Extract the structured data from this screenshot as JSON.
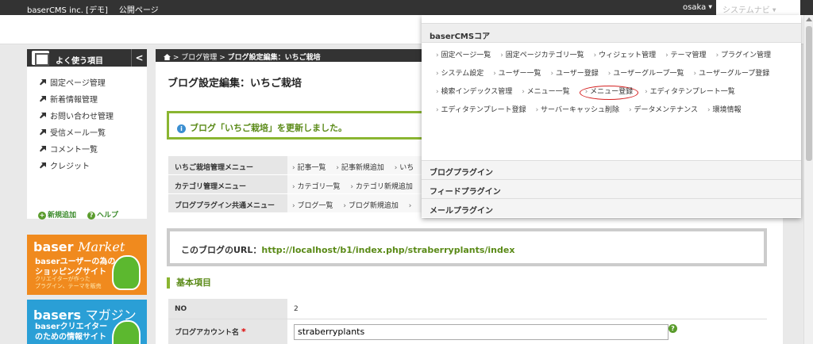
{
  "topbar": {
    "site_name": "baserCMS inc. [デモ]",
    "public_page": "公開ページ",
    "user": "osaka",
    "system_nav": "システムナビ"
  },
  "sidebar": {
    "title": "よく使う項目",
    "toggle": "<",
    "items": [
      {
        "label": "固定ページ管理"
      },
      {
        "label": "新着情報管理"
      },
      {
        "label": "お問い合わせ管理"
      },
      {
        "label": "受信メール一覧"
      },
      {
        "label": "コメント一覧"
      },
      {
        "label": "クレジット"
      }
    ],
    "add_new": "新規追加",
    "help": "ヘルプ"
  },
  "banners": {
    "market": {
      "title_a": "baser",
      "title_b": "Market",
      "line1": "baserユーザーの為の",
      "line2": "ショッピングサイト",
      "small1": "クリエイターが作った",
      "small2": "プラグイン、テーマを販売"
    },
    "magazine": {
      "title_a": "basers",
      "title_b": "マガジン",
      "line1": "baserクリエイター",
      "line2": "のための情報サイト"
    }
  },
  "breadcrumb": {
    "sep": ">",
    "item1": "ブログ管理",
    "item2": "ブログ設定編集：いちご栽培"
  },
  "page_title": "ブログ設定編集：いちご栽培",
  "flash": "ブログ「いちご栽培」を更新しました。",
  "menus": [
    {
      "label": "いちご栽培管理メニュー",
      "links": [
        "記事一覧",
        "記事新規追加",
        "いち"
      ]
    },
    {
      "label": "カテゴリ管理メニュー",
      "links": [
        "カテゴリ一覧",
        "カテゴリ新規追加"
      ]
    },
    {
      "label": "ブログプラグイン共通メニュー",
      "links": [
        "ブログ一覧",
        "ブログ新規追加",
        ""
      ]
    }
  ],
  "url_box": {
    "label": "このブログのURL：",
    "url": "http://localhost/b1/index.php/straberryplants/index"
  },
  "section_title": "基本項目",
  "form": {
    "no_label": "NO",
    "no_value": "2",
    "account_label": "ブログアカウント名",
    "required": "*",
    "account_value": "straberryplants",
    "help": "?"
  },
  "dropdown": {
    "core_title": "baserCMSコア",
    "core_links": [
      "固定ページ一覧",
      "固定ページカテゴリ一覧",
      "ウィジェット管理",
      "テーマ管理",
      "プラグイン管理",
      "システム設定",
      "ユーザー一覧",
      "ユーザー登録",
      "ユーザーグループ一覧",
      "ユーザーグループ登録",
      "検索インデックス管理",
      "メニュー一覧",
      "メニュー登録",
      "エディタテンプレート一覧",
      "エディタテンプレート登録",
      "サーバーキャッシュ削除",
      "データメンテナンス",
      "環境情報"
    ],
    "highlighted_link": "メニュー登録",
    "plugins": [
      "ブログプラグイン",
      "フィードプラグイン",
      "メールプラグイン"
    ]
  },
  "colors": {
    "accent_green": "#8ab531",
    "dark_bar": "#333333",
    "highlight_circle": "#d42020"
  }
}
